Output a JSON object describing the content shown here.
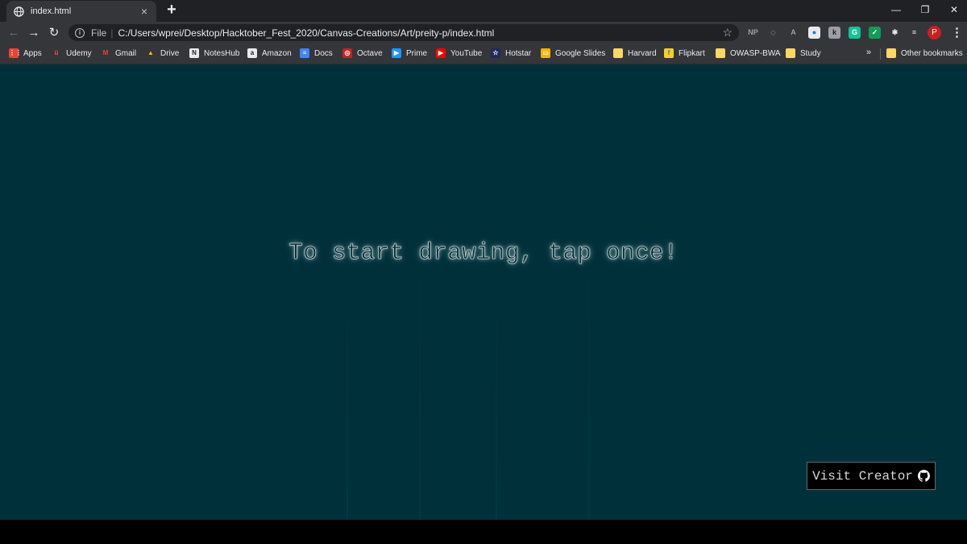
{
  "tab": {
    "title": "index.html",
    "close_glyph": "×",
    "new_tab_glyph": "+"
  },
  "window_controls": {
    "minimize": "—",
    "restore": "❐",
    "close": "✕"
  },
  "toolbar": {
    "back_glyph": "←",
    "forward_glyph": "→",
    "reload_glyph": "↻",
    "scheme_label": "File",
    "separator": "|",
    "url": "C:/Users/wprei/Desktop/Hacktober_Fest_2020/Canvas-Creations/Art/preity-p/index.html",
    "star_glyph": "☆",
    "avatar_initial": "P",
    "menu_glyph": "⋮",
    "extensions": [
      {
        "label": "NP",
        "icon": "np-extension-icon",
        "color": "#35363a",
        "text": "#9aa0a6"
      },
      {
        "label": "◇",
        "icon": "code-extension-icon",
        "color": "#35363a",
        "text": "#5f6368"
      },
      {
        "label": "A",
        "icon": "pdf-extension-icon",
        "color": "#35363a",
        "text": "#9aa0a6"
      },
      {
        "label": "●",
        "icon": "chrome-extension-icon",
        "color": "#e8eaed",
        "text": "#1a73e8"
      },
      {
        "label": "k",
        "icon": "k-extension-icon",
        "color": "#9aa0a6",
        "text": "#202124"
      },
      {
        "label": "G",
        "icon": "grammarly-extension-icon",
        "color": "#15c39a",
        "text": "#ffffff"
      },
      {
        "label": "✓",
        "icon": "shield-extension-icon",
        "color": "#0f9d58",
        "text": "#ffffff"
      },
      {
        "label": "✱",
        "icon": "puzzle-extensions-icon",
        "color": "#35363a",
        "text": "#e8eaed"
      },
      {
        "label": "≡",
        "icon": "media-control-icon",
        "color": "#35363a",
        "text": "#e8eaed"
      }
    ]
  },
  "bookmarks": {
    "items": [
      {
        "label": "Apps",
        "icon": "apps-grid-icon",
        "color": "#ea4335",
        "glyph": "⋮⋮"
      },
      {
        "label": "Udemy",
        "icon": "udemy-icon",
        "color": "#35363a",
        "glyph": "ü",
        "text": "#ec5252"
      },
      {
        "label": "Gmail",
        "icon": "gmail-icon",
        "color": "#35363a",
        "glyph": "M",
        "text": "#ea4335"
      },
      {
        "label": "Drive",
        "icon": "drive-icon",
        "color": "#35363a",
        "glyph": "▲",
        "text": "#fbbc04"
      },
      {
        "label": "NotesHub",
        "icon": "noteshub-icon",
        "color": "#e8eaed",
        "glyph": "N",
        "text": "#202124"
      },
      {
        "label": "Amazon",
        "icon": "amazon-icon",
        "color": "#e8eaed",
        "glyph": "a",
        "text": "#202124"
      },
      {
        "label": "Docs",
        "icon": "docs-icon",
        "color": "#4285f4",
        "glyph": "≡",
        "text": "#ffffff"
      },
      {
        "label": "Octave",
        "icon": "octave-icon",
        "color": "#c5221f",
        "glyph": "◎",
        "text": "#ffffff"
      },
      {
        "label": "Prime",
        "icon": "prime-icon",
        "color": "#1a98ff",
        "glyph": "▶",
        "text": "#ffffff"
      },
      {
        "label": "YouTube",
        "icon": "youtube-icon",
        "color": "#ff0000",
        "glyph": "▶",
        "text": "#ffffff"
      },
      {
        "label": "Hotstar",
        "icon": "hotstar-icon",
        "color": "#1f2a5c",
        "glyph": "☆",
        "text": "#ffffff"
      },
      {
        "label": "Google Slides",
        "icon": "slides-icon",
        "color": "#f4b400",
        "glyph": "▭",
        "text": "#ffffff"
      },
      {
        "label": "Harvard",
        "icon": "folder-icon",
        "color": "#fdd663",
        "glyph": "",
        "text": "#ffffff"
      },
      {
        "label": "Flipkart",
        "icon": "flipkart-icon",
        "color": "#f8d01c",
        "glyph": "f",
        "text": "#2874f0"
      },
      {
        "label": "OWASP-BWA",
        "icon": "folder-icon",
        "color": "#fdd663",
        "glyph": "",
        "text": "#ffffff"
      },
      {
        "label": "Study",
        "icon": "folder-icon",
        "color": "#fdd663",
        "glyph": "",
        "text": "#ffffff"
      }
    ],
    "more_glyph": "»",
    "other_label": "Other bookmarks"
  },
  "page": {
    "prompt": "To start drawing, tap once!",
    "visit_button_label": "Visit Creator",
    "background": "#00313b"
  }
}
